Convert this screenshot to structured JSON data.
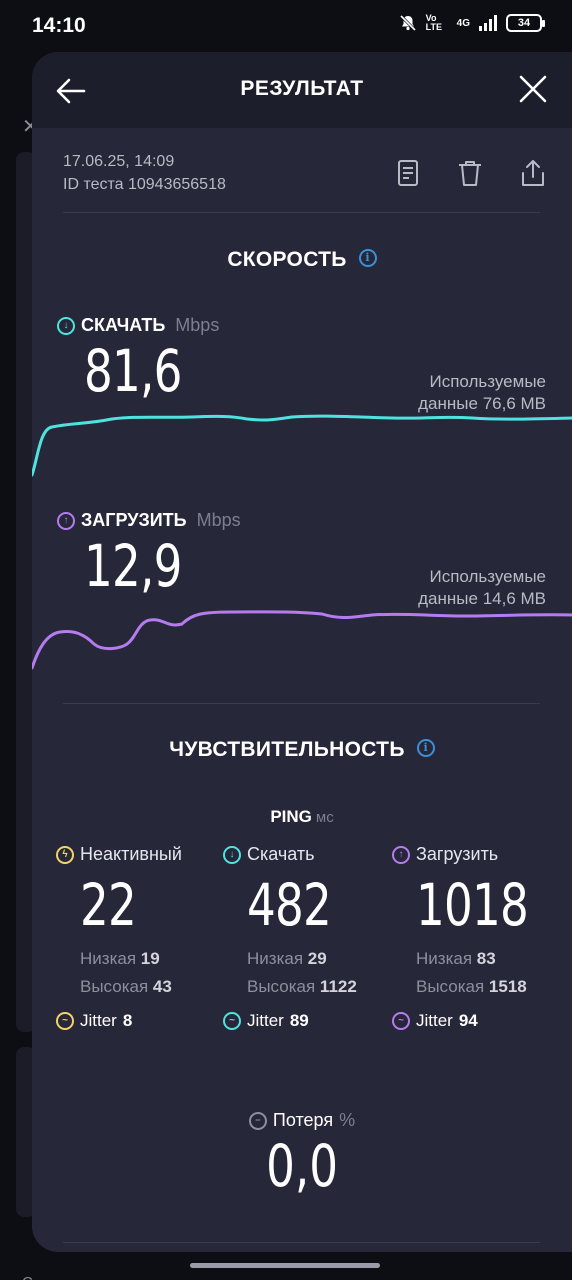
{
  "status_bar": {
    "time": "14:10",
    "network": "4G",
    "volte": "Vo LTE",
    "battery": "34"
  },
  "header": {
    "title": "РЕЗУЛЬТАТ"
  },
  "meta": {
    "date": "17.06.25, 14:09",
    "test_id": "ID теста 10943656518"
  },
  "speed": {
    "title": "СКОРОСТЬ",
    "download": {
      "label": "СКАЧАТЬ",
      "unit": "Mbps",
      "value": "81,6",
      "used_line1": "Используемые",
      "used_line2": "данные 76,6 MB",
      "color": "#4fe3e0"
    },
    "upload": {
      "label": "ЗАГРУЗИТЬ",
      "unit": "Mbps",
      "value": "12,9",
      "used_line1": "Используемые",
      "used_line2": "данные 14,6 MB",
      "color": "#b57cf0"
    }
  },
  "responsiveness": {
    "title": "ЧУВСТВИТЕЛЬНОСТЬ",
    "ping_label": "PING",
    "ping_unit": "мс",
    "columns": [
      {
        "label": "Неактивный",
        "value": "22",
        "low_label": "Низкая",
        "low": "19",
        "high_label": "Высокая",
        "high": "43",
        "jitter_label": "Jitter",
        "jitter": "8",
        "color": "#f2d36b"
      },
      {
        "label": "Скачать",
        "value": "482",
        "low_label": "Низкая",
        "low": "29",
        "high_label": "Высокая",
        "high": "1122",
        "jitter_label": "Jitter",
        "jitter": "89",
        "color": "#4fe3e0"
      },
      {
        "label": "Загрузить",
        "value": "1018",
        "low_label": "Низкая",
        "low": "83",
        "high_label": "Высокая",
        "high": "1518",
        "jitter_label": "Jitter",
        "jitter": "94",
        "color": "#b57cf0"
      }
    ],
    "loss": {
      "label": "Потеря",
      "unit": "%",
      "value": "0,0"
    }
  }
}
